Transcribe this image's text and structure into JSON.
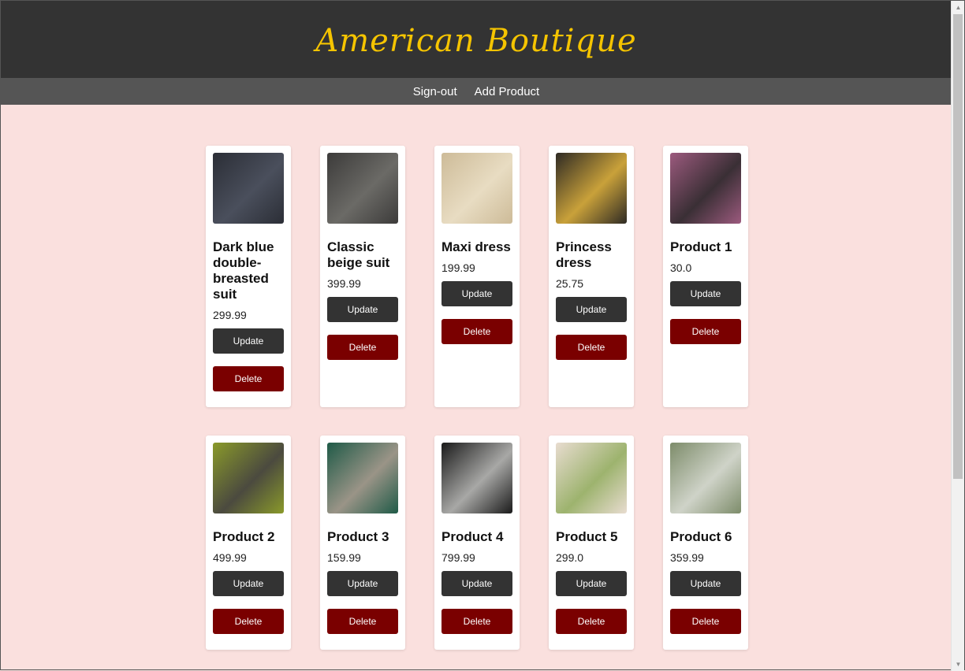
{
  "header": {
    "brand": "American Boutique"
  },
  "nav": {
    "signout": "Sign-out",
    "add_product": "Add Product"
  },
  "buttons": {
    "update": "Update",
    "delete": "Delete"
  },
  "products": [
    {
      "name": "Dark blue double-breasted suit",
      "price": "299.99",
      "image_icon": "dark-suit-photo",
      "colors": [
        "#2b2e36",
        "#4a4f5c"
      ]
    },
    {
      "name": "Classic beige suit",
      "price": "399.99",
      "image_icon": "checked-suit-photo",
      "colors": [
        "#3c3b3a",
        "#6b6a66"
      ]
    },
    {
      "name": "Maxi dress",
      "price": "199.99",
      "image_icon": "sequin-dress-photo",
      "colors": [
        "#cdbb98",
        "#e8dcc2"
      ]
    },
    {
      "name": "Princess dress",
      "price": "25.75",
      "image_icon": "girl-dress-photo",
      "colors": [
        "#2e2a24",
        "#c9a13a"
      ]
    },
    {
      "name": "Product 1",
      "price": "30.0",
      "image_icon": "pink-suit-photo",
      "colors": [
        "#9c5a7e",
        "#3a2f35"
      ]
    },
    {
      "name": "Product 2",
      "price": "499.99",
      "image_icon": "green-dress-photo",
      "colors": [
        "#8a9a2a",
        "#4b4a3f"
      ]
    },
    {
      "name": "Product 3",
      "price": "159.99",
      "image_icon": "green-fur-coat-photo",
      "colors": [
        "#1f5a47",
        "#9a9487"
      ]
    },
    {
      "name": "Product 4",
      "price": "799.99",
      "image_icon": "run-hoodie-photo",
      "colors": [
        "#1a1a1a",
        "#a8a8a6"
      ]
    },
    {
      "name": "Product 5",
      "price": "299.0",
      "image_icon": "bridal-bouquet-photo",
      "colors": [
        "#e8dcd0",
        "#9db36e"
      ]
    },
    {
      "name": "Product 6",
      "price": "359.99",
      "image_icon": "olive-blazer-photo",
      "colors": [
        "#7d8c6a",
        "#cfd3c8"
      ]
    }
  ],
  "colors": {
    "header_bg": "#333333",
    "nav_bg": "#555555",
    "page_bg": "#fae0de",
    "brand": "#f5c400",
    "delete_bg": "#7a0000",
    "update_bg": "#333333"
  }
}
